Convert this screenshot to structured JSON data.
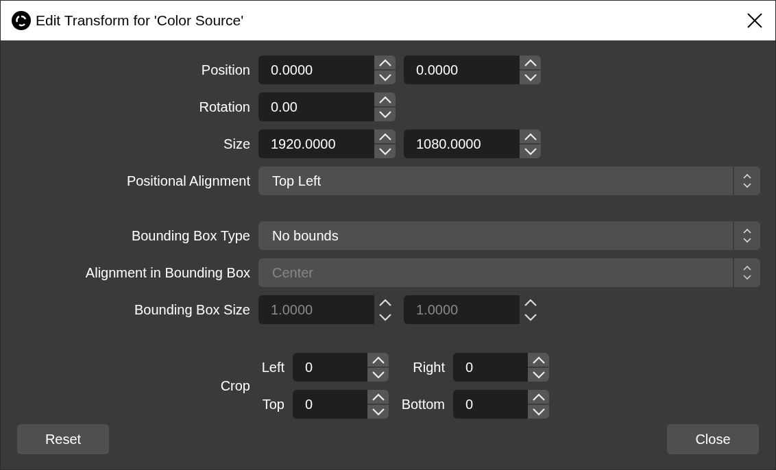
{
  "window": {
    "title": "Edit Transform for 'Color Source'"
  },
  "sections": [
    {
      "rows": [
        {
          "label": "Position",
          "kind": "spin",
          "disabled": false,
          "fields": [
            {
              "value": "0.0000"
            },
            {
              "value": "0.0000"
            }
          ]
        },
        {
          "label": "Rotation",
          "kind": "spin",
          "disabled": false,
          "fields": [
            {
              "value": "0.00"
            }
          ]
        },
        {
          "label": "Size",
          "kind": "spin",
          "disabled": false,
          "fields": [
            {
              "value": "1920.0000"
            },
            {
              "value": "1080.0000"
            }
          ]
        },
        {
          "label": "Positional Alignment",
          "kind": "combo",
          "disabled": false,
          "value": "Top Left"
        }
      ]
    },
    {
      "rows": [
        {
          "label": "Bounding Box Type",
          "kind": "combo",
          "disabled": false,
          "value": "No bounds"
        },
        {
          "label": "Alignment in Bounding Box",
          "kind": "combo",
          "disabled": true,
          "value": "Center"
        },
        {
          "label": "Bounding Box Size",
          "kind": "spin",
          "disabled": true,
          "fields": [
            {
              "value": "1.0000"
            },
            {
              "value": "1.0000"
            }
          ]
        }
      ]
    }
  ],
  "crop": {
    "label": "Crop",
    "fields": [
      {
        "label": "Left",
        "value": "0"
      },
      {
        "label": "Right",
        "value": "0"
      },
      {
        "label": "Top",
        "value": "0"
      },
      {
        "label": "Bottom",
        "value": "0"
      }
    ]
  },
  "buttons": [
    {
      "label": "Reset"
    },
    {
      "label": "Close"
    }
  ]
}
